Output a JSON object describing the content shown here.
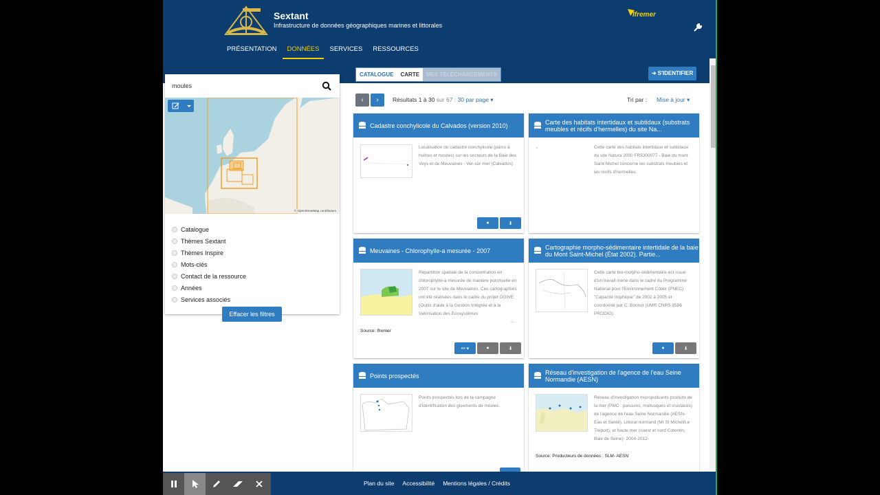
{
  "header": {
    "site_name": "Sextant",
    "tagline": "Infrastructure de données géographiques marines et littorales",
    "partner_logo": "Ifremer",
    "nav": [
      "PRÉSENTATION",
      "DONNÉES",
      "SERVICES",
      "RESSOURCES"
    ],
    "nav_active": "DONNÉES"
  },
  "view_tabs": [
    "CATALOGUE",
    "CARTE",
    "MES TÉLÉCHARGEMENTS"
  ],
  "login_label": "S'IDENTIFIER",
  "search": {
    "value": "moules"
  },
  "map": {
    "credit": "© OpenStreetMap contributors"
  },
  "facets": [
    "Catalogue",
    "Thèmes Sextant",
    "Thèmes Inspire",
    "Mots-clés",
    "Contact de la ressource",
    "Années",
    "Services associés"
  ],
  "clear_filters": "Effacer les filtres",
  "results": {
    "prefix": "Résultats 1 à 30",
    "total": "sur 67 :",
    "per_page": "30 par page",
    "sort_label": "Tri par :",
    "sort_value": "Mise à jour"
  },
  "cards": [
    {
      "title": "Cadastre conchylicole du Calvados (version 2010)",
      "description": "Localisation du cadastre conchylicole (parcs à huitres et moules) sur les secteurs de la Baie des Veys et de Meuvaines - Ver-sur-mer (Calvados)",
      "source": ""
    },
    {
      "title": "Carte des habitats intertidaux et subtidaux (substrats meubles et récifs d'hermelles) du site Na...",
      "description": "Cette carte des habitats intertidaux et subtidaux du site Natura 2000 FR5300077 - Baie du mont Saint-Michel concerne les substrats meubles et les récifs d'hermelles.",
      "source": ""
    },
    {
      "title": "Meuvaines - Chlorophylle-a mesurée - 2007",
      "description": "Répartition spatiale de la concentration en chlorophylle-a mesurée de manière ponctuelle en 2007 sur le site de Meuvaines. Ces cartographies ont été réalisées dans le cadre du projet OGIVE (Outils d'aide à la Gestion Intégrée et à la Valorisation des Ecosystèmes",
      "more": "...",
      "source": "Source: Ifremer"
    },
    {
      "title": "Cartographie morpho-sédimentaire intertidale de la baie du Mont Saint-Michel (État 2002). Partie...",
      "description": "Cette carte bio-morpho-sédimentaire est issue d'un travail mené dans le cadre du Programme National pour l'Environnement Côtier (PNEC) \"Capacité trophique\" de 2002 à 2005 et coordonné par C. Bonnot (UMR CNRS 8586 PRODIG).",
      "source": ""
    },
    {
      "title": "Points prospectés",
      "description": "Points prospectés lors de la campagne d'identification des gisements de moules.",
      "source": ""
    },
    {
      "title": "Réseau d'investigation de l'agence de l'eau Seine Normandie (AESN)",
      "description": "Réseau d'investigation micropolluants produits de la mer (PMC : poissons, mollusques et crustacés) de l'agence de l'eau Seine Normandie (AESN- Eau et Santé). Littoral normand (Mt St Michel/Le Tréport), et haute mer (ouest et nord Cotentin, Baie de Seine)- 2004-2012-",
      "source": "Source: Producteurs de données : SLM- AESN"
    }
  ],
  "footer": [
    "Plan du site",
    "Accessibilité",
    "Mentions légales / Crédits"
  ],
  "colors": {
    "header": "#0d3d6e",
    "primary": "#2f7cc1",
    "highlight": "#f0d000"
  }
}
